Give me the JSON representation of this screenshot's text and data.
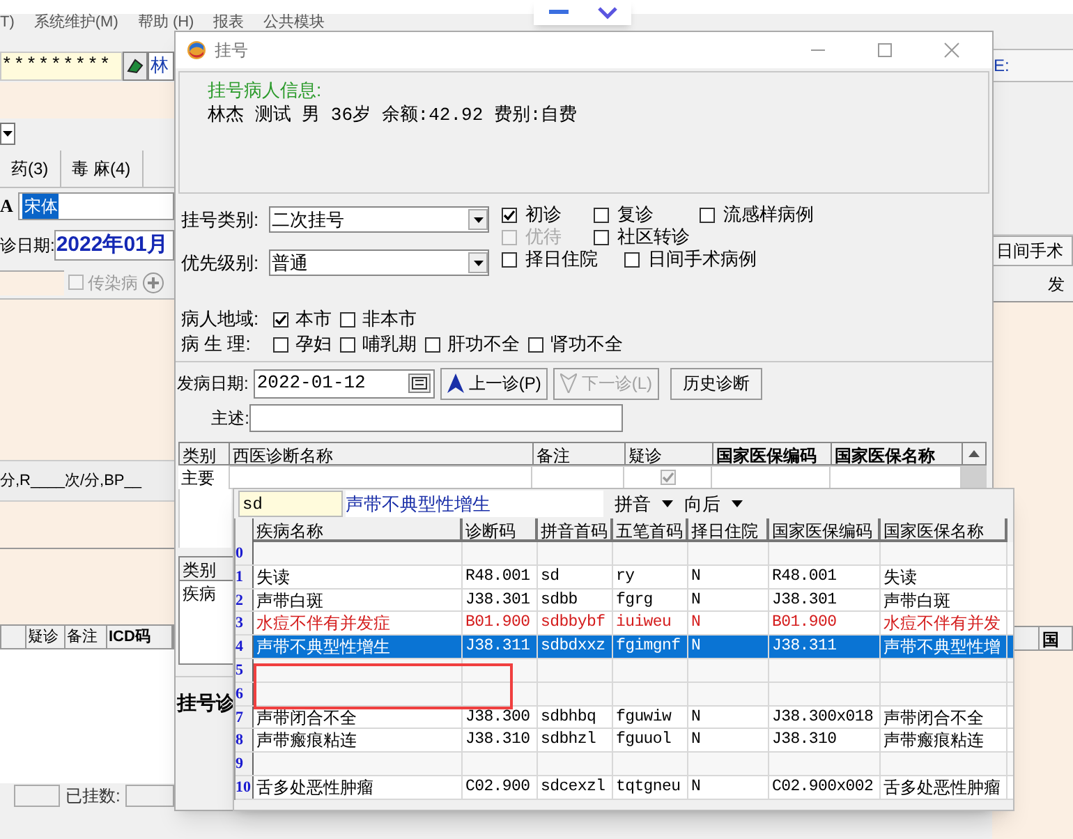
{
  "main_window": {
    "menu": [
      "T)",
      "系统维护(M)",
      "帮助 (H)",
      "报表",
      "公共模块"
    ],
    "password_field": "*********",
    "name_field": "林",
    "tabs": [
      {
        "label": "药(3)",
        "selected": false
      },
      {
        "label": "毒 麻(4)",
        "selected": false
      }
    ],
    "font_field": {
      "label": "A",
      "value": "宋体"
    },
    "visit_date": {
      "label": "诊日期:",
      "value": "2022年01月"
    },
    "infectious": {
      "label": "传染病",
      "checked": false,
      "disabled": true
    },
    "vitals_text": "分,R____次/分,BP__",
    "table_columns": [
      "疑诊",
      "备注",
      "ICD码"
    ],
    "status_label": "已挂数:",
    "right_label": "E:",
    "right_button": "日间手术",
    "right_header": "发",
    "right_table_header": "国"
  },
  "dialog": {
    "title": "挂号",
    "patient_info": {
      "heading": "挂号病人信息:",
      "line": "林杰 测试 男 36岁 余额:42.92 费别:自费"
    },
    "reg_type": {
      "label": "挂号类别:",
      "value": "二次挂号"
    },
    "priority": {
      "label": "优先级别:",
      "value": "普通"
    },
    "option_rows": [
      [
        {
          "label": "初诊",
          "checked": true,
          "disabled": false
        },
        {
          "label": "复诊",
          "checked": false,
          "disabled": false
        },
        {
          "label": "流感样病例",
          "checked": false,
          "disabled": false
        }
      ],
      [
        {
          "label": "优待",
          "checked": false,
          "disabled": true
        },
        {
          "label": "社区转诊",
          "checked": false,
          "disabled": false
        }
      ],
      [
        {
          "label": "择日住院",
          "checked": false,
          "disabled": false
        },
        {
          "label": "日间手术病例",
          "checked": false,
          "disabled": false
        }
      ]
    ],
    "region": {
      "label": "病人地域:",
      "options": [
        {
          "label": "本市",
          "checked": true
        },
        {
          "label": "非本市",
          "checked": false
        }
      ]
    },
    "physiology": {
      "label": "病 生 理:",
      "options": [
        {
          "label": "孕妇",
          "checked": false
        },
        {
          "label": "哺乳期",
          "checked": false
        },
        {
          "label": "肝功不全",
          "checked": false
        },
        {
          "label": "肾功不全",
          "checked": false
        }
      ]
    },
    "onset_date": {
      "label": "发病日期:",
      "value": "2022-01-12"
    },
    "buttons": [
      {
        "label": "上一诊(P)",
        "disabled": false
      },
      {
        "label": "下一诊(L)",
        "disabled": true
      },
      {
        "label": "历史诊断",
        "disabled": false
      }
    ],
    "complaint": {
      "label": "主述:"
    },
    "diagnosis_table": {
      "columns": [
        "类别",
        "西医诊断名称",
        "备注",
        "疑诊",
        "国家医保编码",
        "国家医保名称"
      ],
      "rows": [
        {
          "category": "主要",
          "suspected": true,
          "suspected_disabled": true
        }
      ]
    },
    "second_table": {
      "columns": [
        "类别"
      ],
      "rows": [
        "疾病"
      ]
    },
    "section_label": "挂号诊"
  },
  "popup": {
    "search": {
      "value": "sd"
    },
    "match": "声带不典型性增生",
    "dropdowns": [
      "拼音",
      "向后"
    ],
    "columns": [
      "疾病名称",
      "诊断码",
      "拼音首码",
      "五笔首码",
      "择日住院",
      "国家医保编码",
      "国家医保名称"
    ],
    "rows": [
      {
        "index": "0",
        "kind": "faded",
        "selected": false
      },
      {
        "index": "1",
        "kind": "normal",
        "selected": false,
        "cells": [
          "失读",
          "R48.001",
          "sd",
          "ry",
          "N",
          "R48.001",
          "失读"
        ]
      },
      {
        "index": "2",
        "kind": "normal",
        "selected": false,
        "cells": [
          "声带白斑",
          "J38.301",
          "sdbb",
          "fgrg",
          "N",
          "J38.301",
          "声带白斑"
        ]
      },
      {
        "index": "3",
        "kind": "alert",
        "selected": false,
        "cells": [
          "水痘不伴有并发症",
          "B01.900",
          "sdbbybf",
          "iuiweu",
          "N",
          "B01.900",
          "水痘不伴有并发"
        ]
      },
      {
        "index": "4",
        "kind": "normal",
        "selected": true,
        "cells": [
          "声带不典型性增生",
          "J38.311",
          "sdbdxxz",
          "fgimgnf",
          "N",
          "J38.311",
          "声带不典型性增"
        ]
      },
      {
        "index": "5",
        "kind": "faded",
        "selected": false
      },
      {
        "index": "6",
        "kind": "faded",
        "selected": false
      },
      {
        "index": "7",
        "kind": "normal",
        "selected": false,
        "cells": [
          "声带闭合不全",
          "J38.300",
          "sdbhbq",
          "fguwiw",
          "N",
          "J38.300x018",
          "声带闭合不全"
        ]
      },
      {
        "index": "8",
        "kind": "normal",
        "selected": false,
        "cells": [
          "声带瘢痕粘连",
          "J38.310",
          "sdbhzl",
          "fguuol",
          "N",
          "J38.310",
          "声带瘢痕粘连"
        ]
      },
      {
        "index": "9",
        "kind": "faded",
        "selected": false
      },
      {
        "index": "10",
        "kind": "normal",
        "selected": false,
        "cells": [
          "舌多处恶性肿瘤",
          "C02.900",
          "sdcexzl",
          "tqtgneu",
          "N",
          "C02.900x002",
          "舌多处恶性肿瘤"
        ]
      }
    ]
  }
}
